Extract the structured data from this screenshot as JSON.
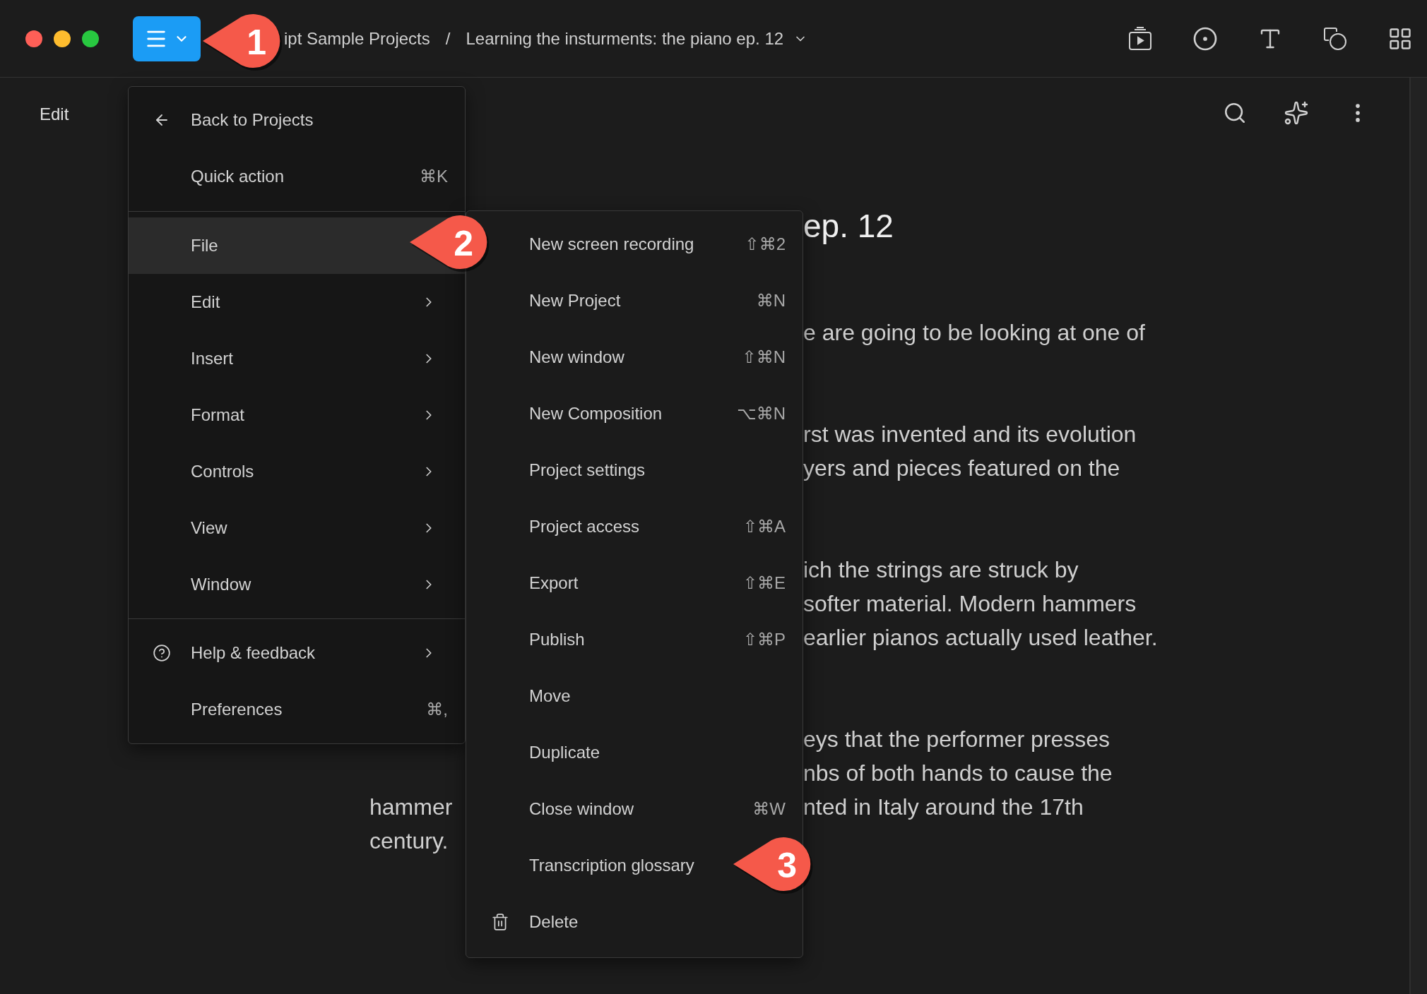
{
  "topbar": {
    "breadcrumb_parent": "ipt Sample Projects",
    "separator": "/",
    "document_title": "Learning the insturments: the piano ep. 12"
  },
  "sidebar": {
    "label": "Edit"
  },
  "document": {
    "title_fragment": "ep. 12",
    "paragraphs": [
      {
        "lines": [
          {
            "right": "e are going to be looking at one of"
          }
        ]
      },
      {
        "lines": [
          {
            "right": "rst was invented and its evolution"
          },
          {
            "right": "yers and pieces featured on the"
          }
        ]
      },
      {
        "lines": [
          {
            "right": "ich the strings are struck by"
          },
          {
            "right": "softer material. Modern hammers"
          },
          {
            "right": "earlier pianos actually used leather."
          }
        ]
      },
      {
        "lines": [
          {
            "right": "eys that the performer presses"
          },
          {
            "right": "nbs of both hands to cause the"
          },
          {
            "left": "hammer",
            "right": "nted in Italy around the 17th"
          },
          {
            "left": "century."
          }
        ]
      }
    ]
  },
  "main_menu": {
    "sections": [
      [
        {
          "label": "Back to Projects",
          "kind": "back",
          "submenu": false,
          "selected": false
        },
        {
          "label": "Quick action",
          "shortcut": "⌘K",
          "submenu": false,
          "selected": false
        }
      ],
      [
        {
          "label": "File",
          "submenu": false,
          "selected": true
        },
        {
          "label": "Edit",
          "submenu": true,
          "selected": false
        },
        {
          "label": "Insert",
          "submenu": true,
          "selected": false
        },
        {
          "label": "Format",
          "submenu": true,
          "selected": false
        },
        {
          "label": "Controls",
          "submenu": true,
          "selected": false
        },
        {
          "label": "View",
          "submenu": true,
          "selected": false
        },
        {
          "label": "Window",
          "submenu": true,
          "selected": false
        }
      ],
      [
        {
          "label": "Help & feedback",
          "kind": "help",
          "submenu": true,
          "selected": false
        },
        {
          "label": "Preferences",
          "shortcut": "⌘,",
          "submenu": false,
          "selected": false
        }
      ]
    ]
  },
  "file_menu": {
    "items": [
      {
        "label": "New screen recording",
        "shortcut": "⇧⌘2"
      },
      {
        "label": "New Project",
        "shortcut": "⌘N"
      },
      {
        "label": "New window",
        "shortcut": "⇧⌘N"
      },
      {
        "label": "New Composition",
        "shortcut": "⌥⌘N"
      },
      {
        "label": "Project settings"
      },
      {
        "label": "Project access",
        "shortcut": "⇧⌘A"
      },
      {
        "label": "Export",
        "shortcut": "⇧⌘E"
      },
      {
        "label": "Publish",
        "shortcut": "⇧⌘P"
      },
      {
        "label": "Move"
      },
      {
        "label": "Duplicate"
      },
      {
        "label": "Close window",
        "shortcut": "⌘W"
      },
      {
        "label": "Transcription glossary"
      },
      {
        "label": "Delete",
        "kind": "delete"
      }
    ]
  },
  "callouts": [
    {
      "number": "1"
    },
    {
      "number": "2"
    },
    {
      "number": "3"
    }
  ]
}
